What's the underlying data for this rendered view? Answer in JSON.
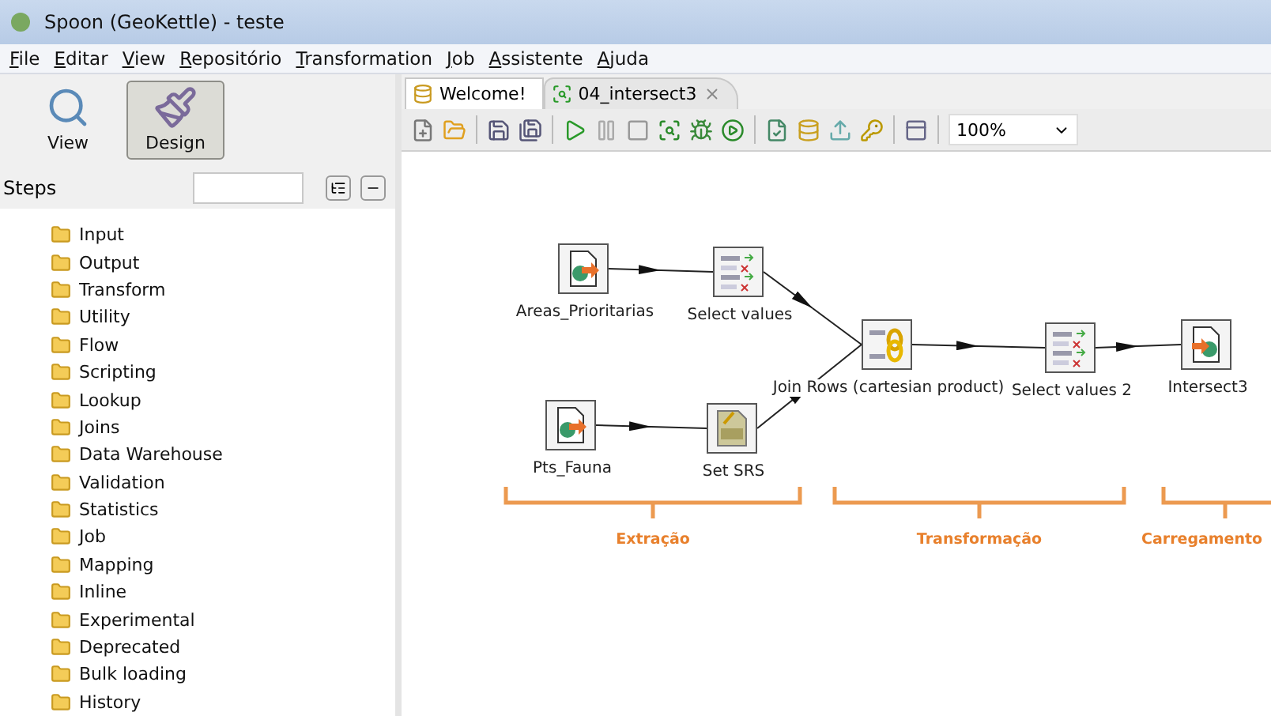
{
  "window": {
    "title": "Spoon (GeoKettle) - teste"
  },
  "menu": [
    "File",
    "Editar",
    "View",
    "Repositório",
    "Transformation",
    "Job",
    "Assistente",
    "Ajuda"
  ],
  "perspectives": [
    {
      "label": "View",
      "kind": "view",
      "selected": false
    },
    {
      "label": "Design",
      "kind": "design",
      "selected": true
    }
  ],
  "steps": {
    "label": "Steps",
    "folders": [
      "Input",
      "Output",
      "Transform",
      "Utility",
      "Flow",
      "Scripting",
      "Lookup",
      "Joins",
      "Data Warehouse",
      "Validation",
      "Statistics",
      "Job",
      "Mapping",
      "Inline",
      "Experimental",
      "Deprecated",
      "Bulk loading",
      "History"
    ]
  },
  "tabs": [
    {
      "label": "Welcome!",
      "kind": "welcome",
      "selected": false,
      "closable": false
    },
    {
      "label": "04_intersect3",
      "kind": "transformation",
      "selected": true,
      "closable": true
    }
  ],
  "toolbar": {
    "zoom": "100%"
  },
  "nodes": [
    {
      "label": "Areas_Prioritarias",
      "kind": "input"
    },
    {
      "label": "Select values",
      "kind": "select"
    },
    {
      "label": "Join Rows (cartesian product)",
      "kind": "join"
    },
    {
      "label": "Select values 2",
      "kind": "select"
    },
    {
      "label": "Intersect3",
      "kind": "output"
    },
    {
      "label": "Pts_Fauna",
      "kind": "input"
    },
    {
      "label": "Set SRS",
      "kind": "srid"
    }
  ],
  "phases": [
    "Extração",
    "Transformação",
    "Carregamento"
  ]
}
